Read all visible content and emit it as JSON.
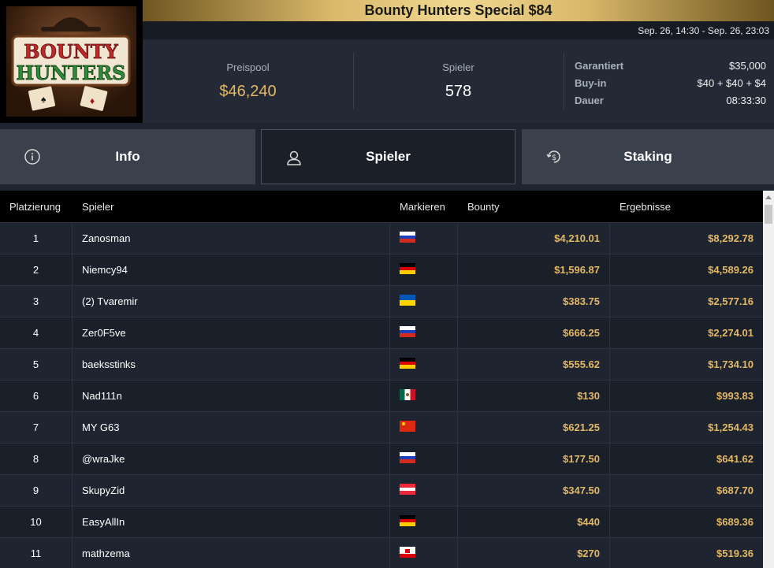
{
  "header": {
    "title": "Bounty Hunters Special $84",
    "dates": "Sep. 26, 14:30 - Sep. 26, 23:03",
    "logo_text": [
      "BOUNTY",
      "HUNTERS"
    ]
  },
  "stats": {
    "prizepool_label": "Preispool",
    "prizepool_value": "$46,240",
    "players_label": "Spieler",
    "players_value": "578",
    "details": [
      {
        "label": "Garantiert",
        "value": "$35,000"
      },
      {
        "label": "Buy-in",
        "value": "$40 + $40 + $4"
      },
      {
        "label": "Dauer",
        "value": "08:33:30"
      }
    ]
  },
  "tabs": [
    {
      "label": "Info",
      "icon": "info-icon"
    },
    {
      "label": "Spieler",
      "icon": "user-icon"
    },
    {
      "label": "Staking",
      "icon": "dollar-cycle-icon"
    }
  ],
  "table": {
    "headers": {
      "place": "Platzierung",
      "player": "Spieler",
      "flag": "Markieren",
      "bounty": "Bounty",
      "result": "Ergebnisse"
    },
    "rows": [
      {
        "place": "1",
        "player": "Zanosman",
        "flag": "RU",
        "bounty": "$4,210.01",
        "result": "$8,292.78"
      },
      {
        "place": "2",
        "player": "Niemcy94",
        "flag": "DE",
        "bounty": "$1,596.87",
        "result": "$4,589.26"
      },
      {
        "place": "3",
        "player": "(2) Tvaremir",
        "flag": "UA",
        "bounty": "$383.75",
        "result": "$2,577.16"
      },
      {
        "place": "4",
        "player": "Zer0F5ve",
        "flag": "RU",
        "bounty": "$666.25",
        "result": "$2,274.01"
      },
      {
        "place": "5",
        "player": "baeksstinks",
        "flag": "DE",
        "bounty": "$555.62",
        "result": "$1,734.10"
      },
      {
        "place": "6",
        "player": "Nad111n",
        "flag": "MX",
        "bounty": "$130",
        "result": "$993.83"
      },
      {
        "place": "7",
        "player": "MY G63",
        "flag": "CN",
        "bounty": "$621.25",
        "result": "$1,254.43"
      },
      {
        "place": "8",
        "player": "@wraJke",
        "flag": "RU",
        "bounty": "$177.50",
        "result": "$641.62"
      },
      {
        "place": "9",
        "player": "SkupyZid",
        "flag": "AT",
        "bounty": "$347.50",
        "result": "$687.70"
      },
      {
        "place": "10",
        "player": "EasyAllIn",
        "flag": "DE",
        "bounty": "$440",
        "result": "$689.36"
      },
      {
        "place": "11",
        "player": "mathzema",
        "flag": "GI",
        "bounty": "$270",
        "result": "$519.36"
      }
    ]
  },
  "colors": {
    "accent": "#e3b865",
    "bg": "#1e2430",
    "header": "#000000"
  }
}
